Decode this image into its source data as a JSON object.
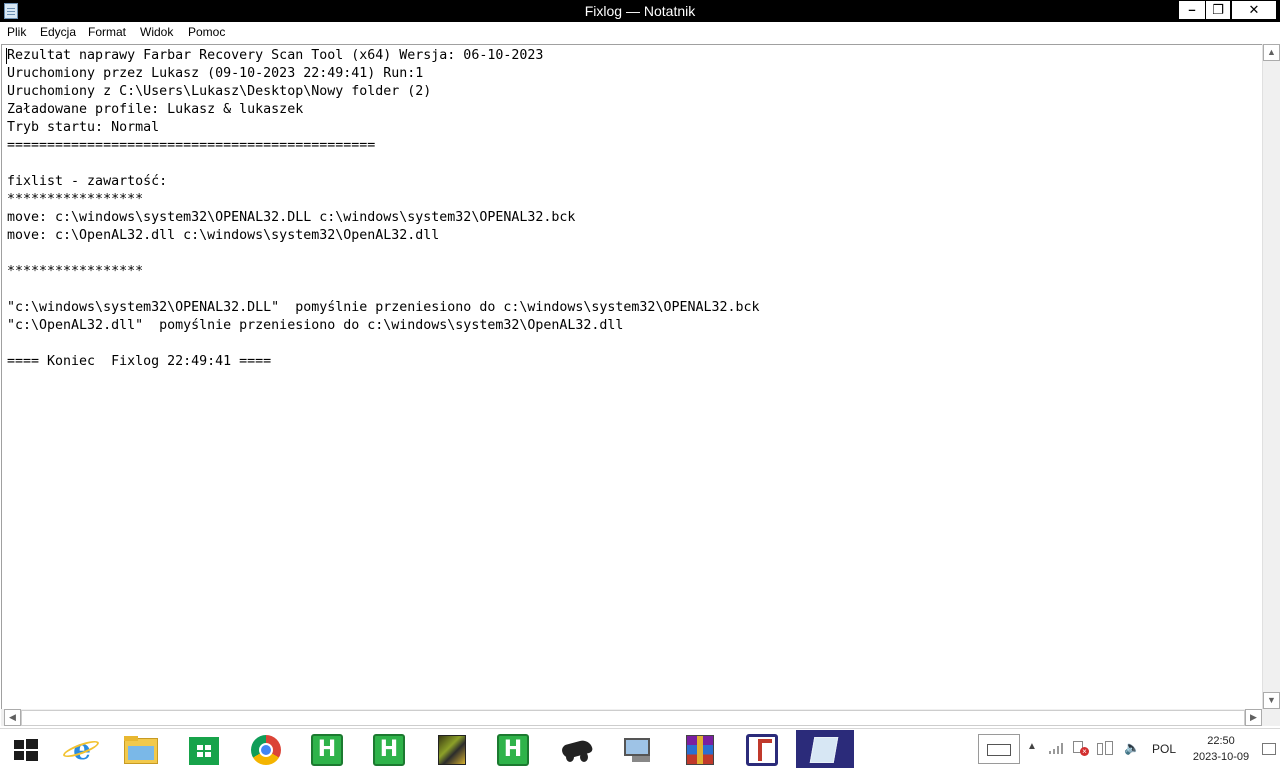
{
  "window": {
    "title": "Fixlog — Notatnik",
    "minimize_glyph": "–",
    "maximize_glyph": "❐",
    "close_glyph": "✕"
  },
  "menu": {
    "items": [
      "Plik",
      "Edycja",
      "Format",
      "Widok",
      "Pomoc"
    ]
  },
  "editor": {
    "content": "Rezultat naprawy Farbar Recovery Scan Tool (x64) Wersja: 06-10-2023\nUruchomiony przez Lukasz (09-10-2023 22:49:41) Run:1\nUruchomiony z C:\\Users\\Lukasz\\Desktop\\Nowy folder (2)\nZaładowane profile: Lukasz & lukaszek\nTryb startu: Normal\n==============================================\n\nfixlist - zawartość:\n*****************\nmove: c:\\windows\\system32\\OPENAL32.DLL c:\\windows\\system32\\OPENAL32.bck\nmove: c:\\OpenAL32.dll c:\\windows\\system32\\OpenAL32.dll\n\n*****************\n\n\"c:\\windows\\system32\\OPENAL32.DLL\"  pomyślnie przeniesiono do c:\\windows\\system32\\OPENAL32.bck\n\"c:\\OpenAL32.dll\"  pomyślnie przeniesiono do c:\\windows\\system32\\OpenAL32.dll\n\n==== Koniec  Fixlog 22:49:41 ===="
  },
  "scrollbars": {
    "up": "▲",
    "down": "▼",
    "left": "◀",
    "right": "▶"
  },
  "taskbar": {
    "apps": [
      {
        "name": "start",
        "icon": "windows-logo-icon"
      },
      {
        "name": "internet-explorer",
        "icon": "e",
        "color": "#2a8be0"
      },
      {
        "name": "file-explorer",
        "icon": "folder-icon",
        "color": "#f2c94c"
      },
      {
        "name": "store",
        "icon": "store-icon",
        "color": "#17a34a"
      },
      {
        "name": "chrome",
        "icon": "chrome-icon"
      },
      {
        "name": "hitman-1",
        "icon": "H",
        "color": "#2fb34a"
      },
      {
        "name": "hitman-2",
        "icon": "H",
        "color": "#2fb34a"
      },
      {
        "name": "game-app",
        "icon": "game-icon"
      },
      {
        "name": "hitman-3",
        "icon": "H",
        "color": "#2fb34a"
      },
      {
        "name": "tools-app",
        "icon": "tools-icon"
      },
      {
        "name": "network-app",
        "icon": "monitor-icon"
      },
      {
        "name": "winrar",
        "icon": "winrar-icon"
      },
      {
        "name": "frst",
        "icon": "frst-icon"
      },
      {
        "name": "notepad",
        "icon": "notepad-icon",
        "active": true
      }
    ],
    "tray": {
      "language": "POL",
      "time": "22:50",
      "date": "2023-10-09"
    }
  }
}
